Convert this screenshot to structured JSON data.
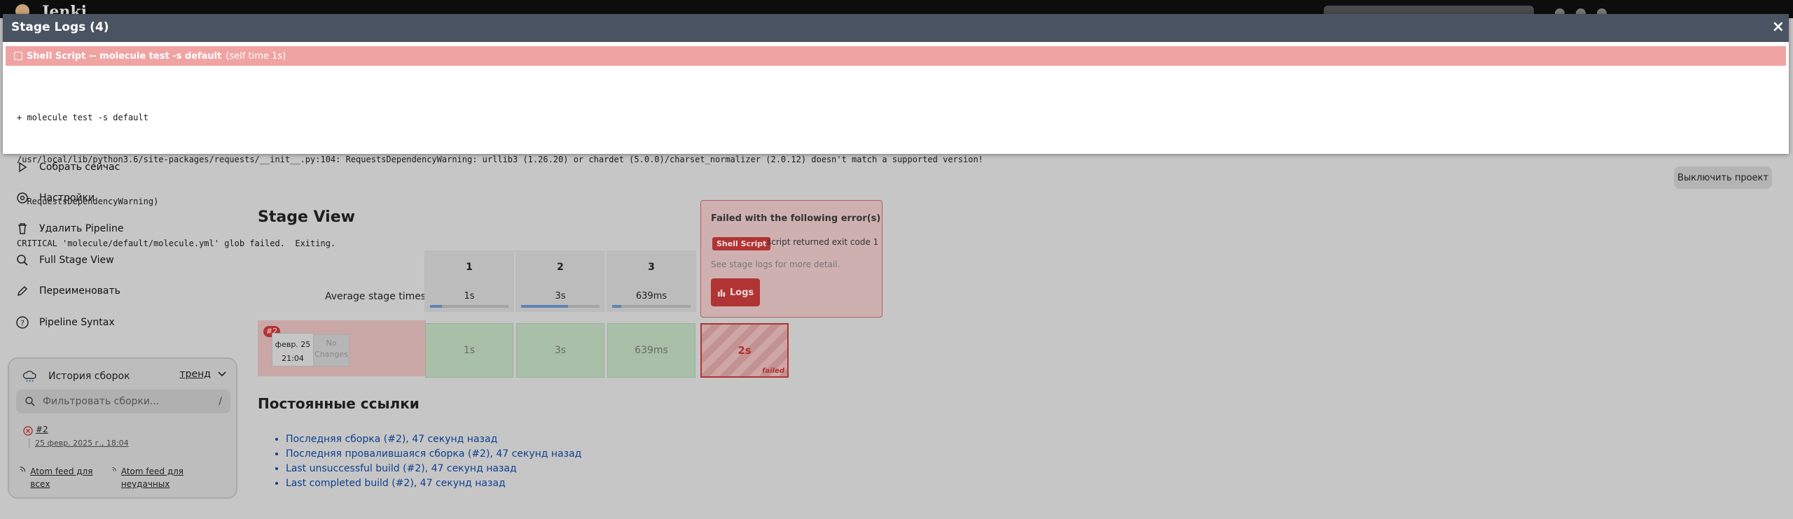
{
  "app": {
    "logo_text": "Jenki"
  },
  "sidebar": {
    "items": [
      {
        "label": "Собрать сейчас",
        "icon": "play-icon"
      },
      {
        "label": "Настройки",
        "icon": "gear-icon"
      },
      {
        "label": "Удалить Pipeline",
        "icon": "trash-icon"
      },
      {
        "label": "Full Stage View",
        "icon": "search-icon"
      },
      {
        "label": "Переименовать",
        "icon": "pencil-icon"
      },
      {
        "label": "Pipeline Syntax",
        "icon": "help-icon"
      }
    ]
  },
  "build_history": {
    "title": "История сборок",
    "trend_label": "тренд",
    "filter_placeholder": "Фильтровать сборки...",
    "filter_shortcut": "/",
    "builds": [
      {
        "number": "#2",
        "date": "25 февр. 2025 г., 18:04",
        "status": "failed"
      }
    ],
    "feed_all": "Atom feed для всех",
    "feed_failed": "Atom feed для неудачных"
  },
  "actions": {
    "disable_project": "Выключить проект"
  },
  "stage_view": {
    "title": "Stage View",
    "average_label": "Average stage times:",
    "columns": [
      "1",
      "2",
      "3"
    ],
    "average_times": [
      "1s",
      "3s",
      "639ms"
    ],
    "average_fill": [
      0.15,
      0.6,
      0.12
    ],
    "run": {
      "badge": "#2",
      "date": "февр. 25",
      "time": "21:04",
      "changes": "No Changes",
      "stage_times": [
        "1s",
        "3s",
        "639ms"
      ],
      "failed_stage_time": "2s",
      "failed_label": "failed"
    }
  },
  "popover": {
    "title": "Failed with the following error(s)",
    "tag": "Shell Script",
    "message": "script returned exit code 1",
    "detail": "See stage logs for more detail.",
    "logs_button": "Logs"
  },
  "permalinks": {
    "title": "Постоянные ссылки",
    "links": [
      "Последняя сборка (#2), 47 секунд назад",
      "Последняя провалившаяся сборка (#2), 47 секунд назад",
      "Last unsuccessful build (#2), 47 секунд назад",
      "Last completed build (#2), 47 секунд назад"
    ]
  },
  "modal": {
    "title": "Stage Logs (4)",
    "close": "×",
    "step_name": "Shell Script -- molecule test -s default",
    "step_time": "(self time 1s)",
    "log_lines": [
      "+ molecule test -s default",
      "/usr/local/lib/python3.6/site-packages/requests/__init__.py:104: RequestsDependencyWarning: urllib3 (1.26.20) or chardet (5.0.0)/charset_normalizer (2.0.12) doesn't match a supported version!",
      "  RequestsDependencyWarning)",
      "CRITICAL 'molecule/default/molecule.yml' glob failed.  Exiting."
    ]
  },
  "colors": {
    "failed": "#b03434",
    "success": "#a9bfa7",
    "modal_header": "#4a5361",
    "log_bar": "#f0a3a3"
  }
}
